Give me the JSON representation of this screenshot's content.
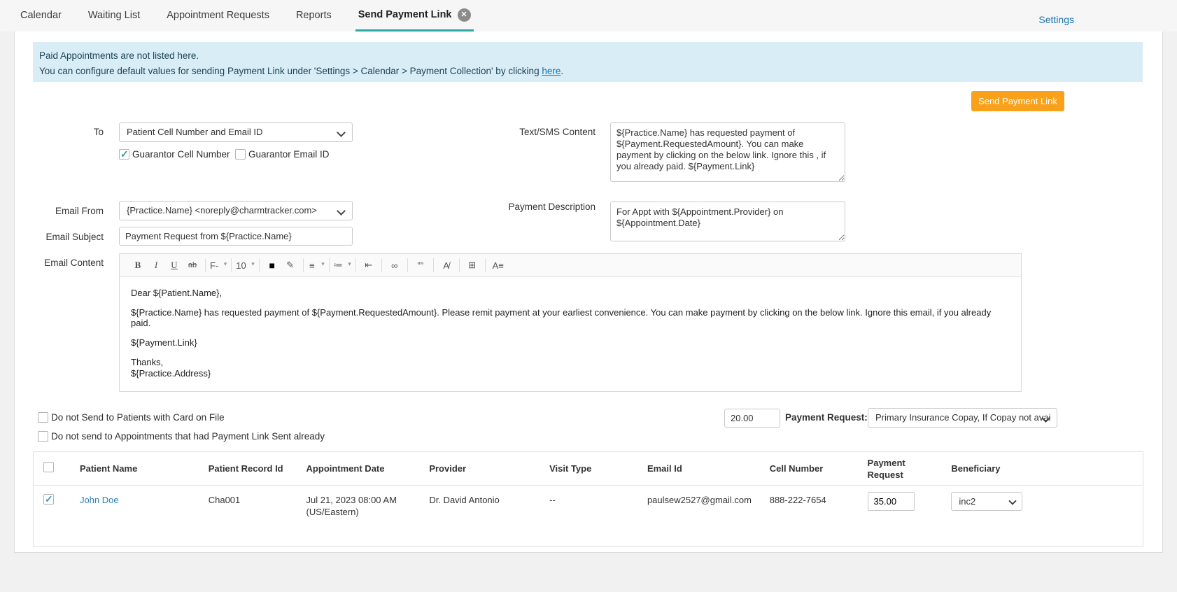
{
  "colors": {
    "accent_teal": "#2ba8a2",
    "button_orange": "#f9a11b",
    "link_blue": "#1874b1",
    "banner_bg": "#d9edf7"
  },
  "tabs": [
    {
      "label": "Calendar"
    },
    {
      "label": "Waiting List"
    },
    {
      "label": "Appointment Requests"
    },
    {
      "label": "Reports"
    },
    {
      "label": "Send Payment Link"
    }
  ],
  "settings_label": "Settings",
  "banner": {
    "line1": "Paid Appointments are not listed here.",
    "line2_prefix": "You can configure default values for sending Payment Link under 'Settings > Calendar > Payment Collection' by clicking ",
    "line2_link": "here",
    "line2_suffix": "."
  },
  "send_button_label": "Send Payment Link",
  "form": {
    "to_label": "To",
    "to_value": "Patient Cell Number and Email ID",
    "guarantor_cell_label": "Guarantor Cell Number",
    "guarantor_cell_checked": true,
    "guarantor_email_label": "Guarantor Email ID",
    "guarantor_email_checked": false,
    "sms_label": "Text/SMS Content",
    "sms_value": "${Practice.Name} has requested payment of ${Payment.RequestedAmount}. You can make payment by clicking on the below link. Ignore this , if you already paid. ${Payment.Link}",
    "email_from_label": "Email From",
    "email_from_value": "{Practice.Name} <noreply@charmtracker.com>",
    "email_subject_label": "Email Subject",
    "email_subject_value": "Payment Request from ${Practice.Name}",
    "payment_desc_label": "Payment Description",
    "payment_desc_value": "For Appt with ${Appointment.Provider} on ${Appointment.Date}",
    "email_content_label": "Email Content"
  },
  "editor": {
    "toolbar": {
      "bold": "B",
      "italic": "I",
      "underline": "U",
      "strike": "ab",
      "font": "F-",
      "size": "10",
      "color": "■",
      "pen": "✎",
      "align": "≡",
      "list": "≔",
      "indent": "⇤",
      "link": "∞",
      "quote": "””",
      "clear": "A̸",
      "table": "⊞",
      "lines": "A≡"
    },
    "body": {
      "p1": "Dear ${Patient.Name},",
      "p2": "${Practice.Name} has requested payment of ${Payment.RequestedAmount}. Please remit payment at your earliest convenience. You can make payment by clicking on the below link. Ignore this email, if you already paid.",
      "p3": "${Payment.Link}",
      "p4": "Thanks,",
      "p5": "${Practice.Address}"
    }
  },
  "options": {
    "no_card_label": "Do not Send to Patients with Card on File",
    "no_card_checked": false,
    "no_resend_label": "Do not send to Appointments that had Payment Link Sent already",
    "no_resend_checked": false,
    "amount_value": "20.00",
    "payment_request_label": "Payment Request:",
    "payment_request_value": "Primary Insurance Copay, If Copay not avai"
  },
  "table": {
    "headers": {
      "patient_name": "Patient Name",
      "record_id": "Patient Record Id",
      "appt_date": "Appointment Date",
      "provider": "Provider",
      "visit_type": "Visit Type",
      "email": "Email Id",
      "cell": "Cell Number",
      "payment_request": "Payment Request",
      "beneficiary": "Beneficiary"
    },
    "row": {
      "checked": true,
      "patient_name": "John Doe",
      "record_id": "Cha001",
      "appt_date": "Jul 21, 2023 08:00 AM (US/Eastern)",
      "provider": "Dr. David Antonio",
      "visit_type": "--",
      "email": "paulsew2527@gmail.com",
      "cell": "888-222-7654",
      "payment_request": "35.00",
      "beneficiary": "inc2"
    }
  }
}
